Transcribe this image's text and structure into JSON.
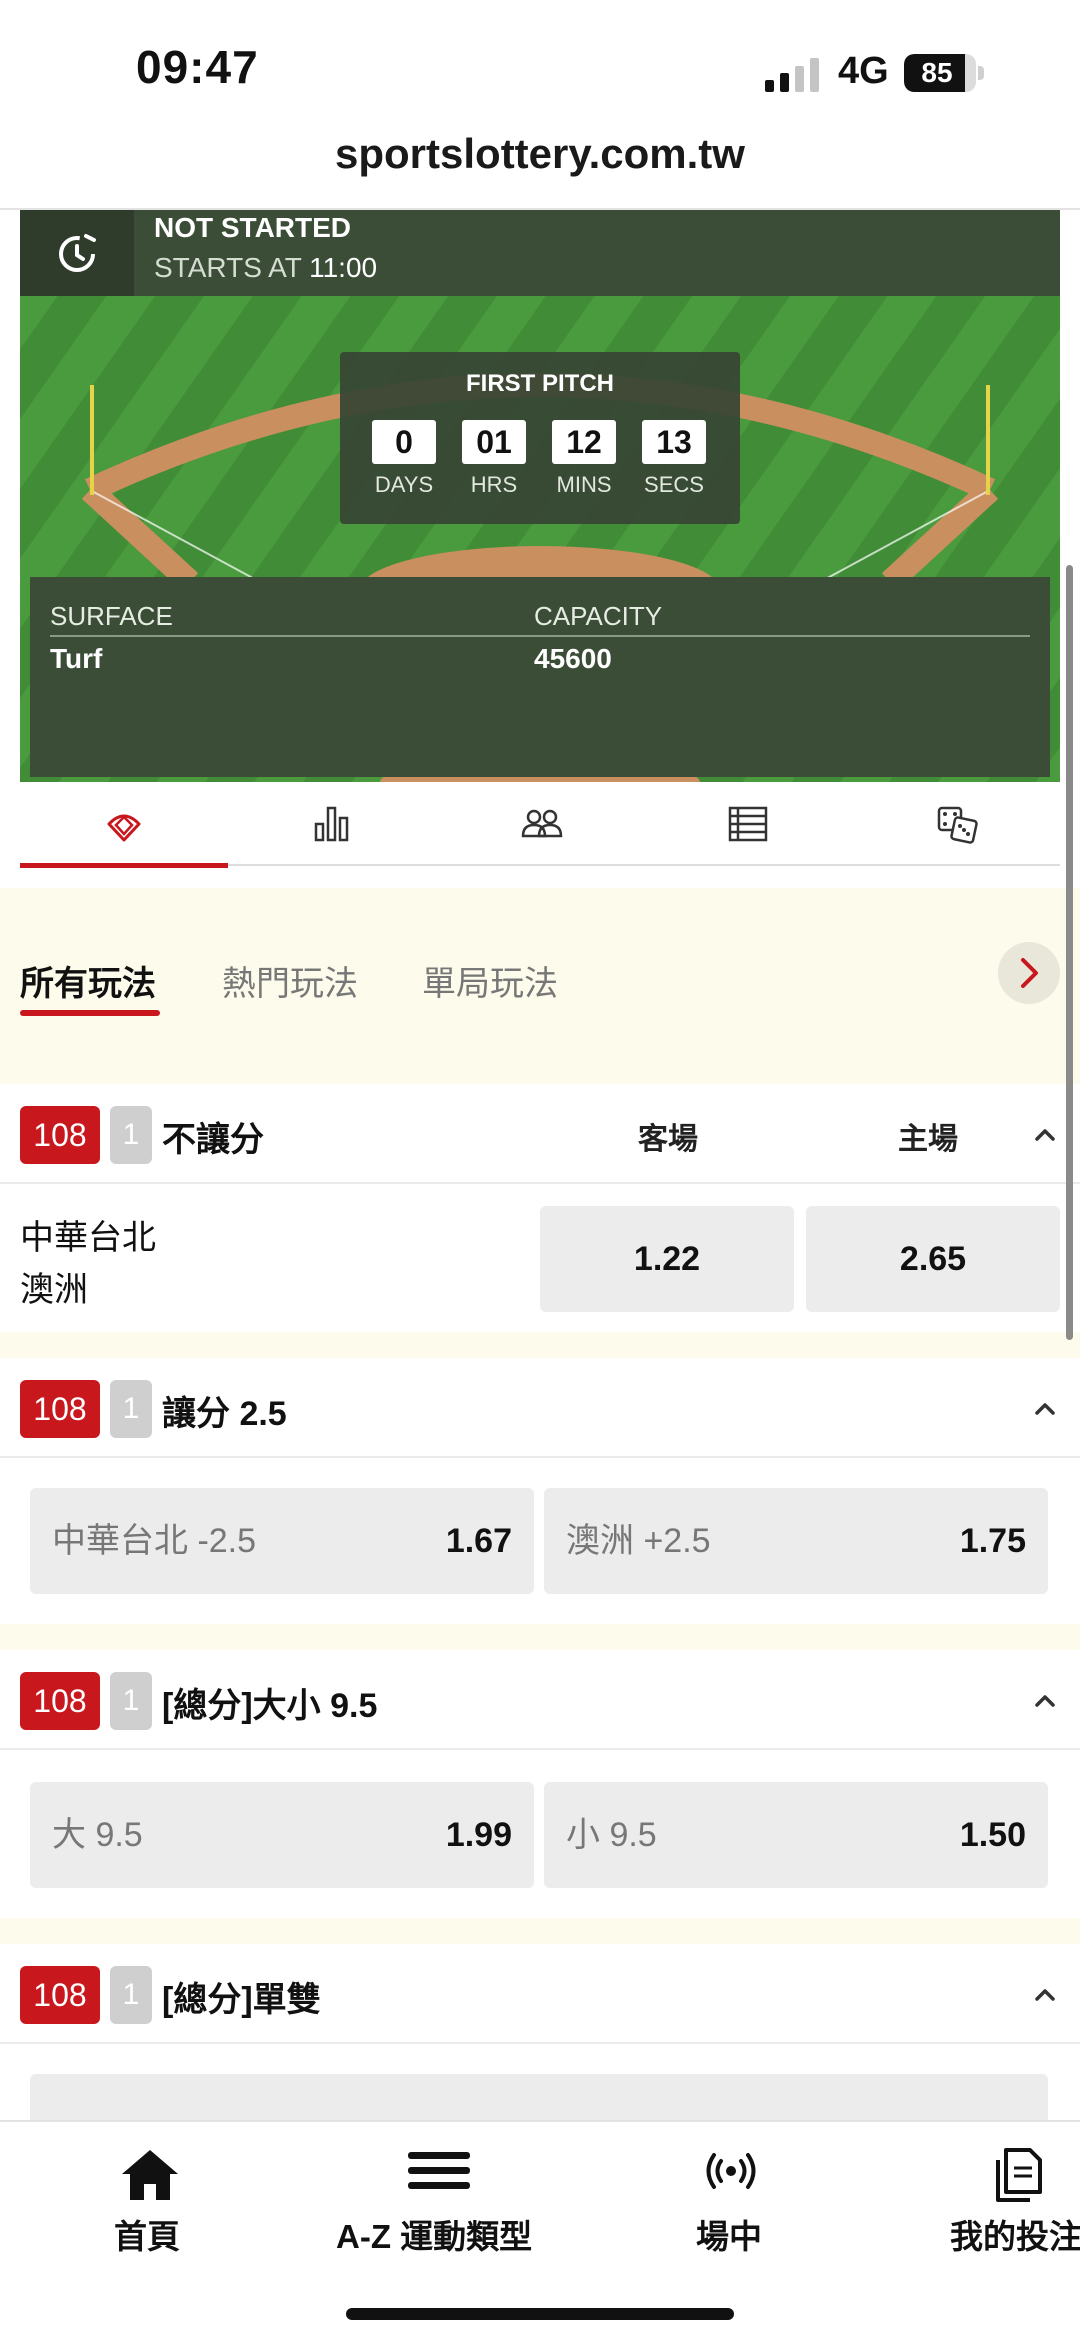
{
  "status_bar": {
    "time": "09:47",
    "network": "4G",
    "battery": "85",
    "battery_level": 0.85
  },
  "browser": {
    "url": "sportslottery.com.tw"
  },
  "match_status": {
    "title": "NOT STARTED",
    "starts_prefix": "STARTS AT",
    "starts_time": "11:00"
  },
  "countdown": {
    "title": "FIRST PITCH",
    "days": "0",
    "days_label": "DAYS",
    "hrs": "01",
    "hrs_label": "HRS",
    "mins": "12",
    "mins_label": "MINS",
    "secs": "13",
    "secs_label": "SECS"
  },
  "venue": {
    "surface_label": "SURFACE",
    "surface": "Turf",
    "capacity_label": "CAPACITY",
    "capacity": "45600"
  },
  "icon_tabs": [
    "baseball-field-icon",
    "stats-icon",
    "lineup-icon",
    "table-icon",
    "dice-icon"
  ],
  "filter_tabs": {
    "all": "所有玩法",
    "popular": "熱門玩法",
    "inning": "單局玩法"
  },
  "markets": [
    {
      "number": "108",
      "seq": "1",
      "title": "不讓分",
      "col_away": "客場",
      "col_home": "主場",
      "team_away": "中華台北",
      "team_home": "澳洲",
      "odds_away": "1.22",
      "odds_home": "2.65"
    },
    {
      "number": "108",
      "seq": "1",
      "title": "讓分 2.5",
      "opt1_label": "中華台北 -2.5",
      "opt1_odds": "1.67",
      "opt2_label": "澳洲 +2.5",
      "opt2_odds": "1.75"
    },
    {
      "number": "108",
      "seq": "1",
      "title": "[總分]大小 9.5",
      "opt1_label": "大 9.5",
      "opt1_odds": "1.99",
      "opt2_label": "小 9.5",
      "opt2_odds": "1.50"
    },
    {
      "number": "108",
      "seq": "1",
      "title": "[總分]單雙"
    }
  ],
  "bottom_nav": {
    "home": "首頁",
    "sports": "A-Z 運動類型",
    "live": "場中",
    "bets": "我的投注"
  },
  "colors": {
    "accent": "#c8171d",
    "field_green": "#3f8a36",
    "panel": "#3b4d37",
    "cream": "#fdfbeb"
  }
}
